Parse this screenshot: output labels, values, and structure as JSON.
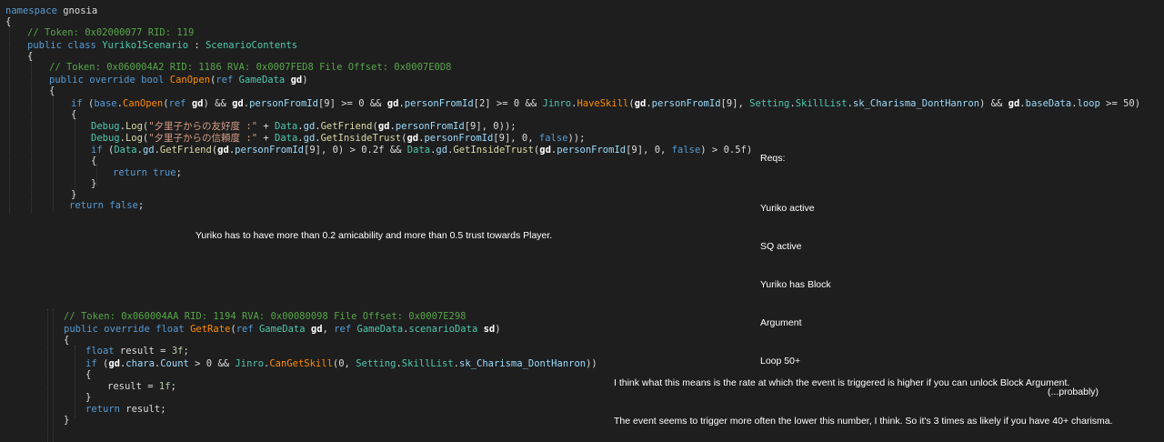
{
  "code_top": {
    "line01_ns_kw": "namespace",
    "line01_ns_name": "gnosia",
    "line02": "{",
    "line03_comment": "// Token: 0x02000077 RID: 119",
    "line04_kw": "public class",
    "line04_name": "Yuriko1Scenario",
    "line04_colon": " : ",
    "line04_base": "ScenarioContents",
    "line05": "{",
    "line06_comment": "// Token: 0x060004A2 RID: 1186 RVA: 0x0007FED8 File Offset: 0x0007E0D8",
    "line07_kw": "public override bool",
    "line07_method": "CanOpen",
    "line07_paren": "(",
    "line07_ref": "ref",
    "line07_type": "GameData",
    "line07_param": "gd",
    "line07_close": ")",
    "line08": "{",
    "line09": {
      "if": "if",
      "p1": " (",
      "base": "base",
      "dot1": ".",
      "canopen": "CanOpen",
      "p2": "(",
      "ref": "ref",
      "gd1": "gd",
      "p3": ") && ",
      "gd2": "gd",
      "dot2": ".",
      "pfi1": "personFromId",
      "idx1": "[9] >= 0 && ",
      "gd3": "gd",
      "dot3": ".",
      "pfi2": "personFromId",
      "idx2": "[2] >= 0 && ",
      "jinro": "Jinro",
      "dot4": ".",
      "haveskill": "HaveSkill",
      "p4": "(",
      "gd4": "gd",
      "dot5": ".",
      "pfi3": "personFromId",
      "idx3": "[9], ",
      "setting": "Setting",
      "dot6": ".",
      "skilllist": "SkillList",
      "dot7": ".",
      "skill": "sk_Charisma_DontHanron",
      "p5": ") && ",
      "gd5": "gd",
      "dot8": ".",
      "basedata": "baseData",
      "dot9": ".",
      "loop": "loop",
      "tail": " >= 50)"
    },
    "line10": "{",
    "line11": {
      "debug": "Debug",
      "dot": ".",
      "log": "Log",
      "p1": "(",
      "str": "\"夕里子からの友好度 :\"",
      "plus": " + ",
      "data": "Data",
      "dot2": ".",
      "gd": "gd",
      "dot3": ".",
      "getfriend": "GetFriend",
      "p2": "(",
      "gdb": "gd",
      "dot4": ".",
      "pfi": "personFromId",
      "tail": "[9], 0));"
    },
    "line12": {
      "debug": "Debug",
      "dot": ".",
      "log": "Log",
      "p1": "(",
      "str": "\"夕里子からの信頼度 :\"",
      "plus": " + ",
      "data": "Data",
      "dot2": ".",
      "gd": "gd",
      "dot3": ".",
      "getinside": "GetInsideTrust",
      "p2": "(",
      "gdb": "gd",
      "dot4": ".",
      "pfi": "personFromId",
      "mid": "[9], 0, ",
      "false": "false",
      "tail": "));"
    },
    "line13": {
      "if": "if",
      "p1": " (",
      "data1": "Data",
      "dot1": ".",
      "gd1": "gd",
      "dot2": ".",
      "getfriend": "GetFriend",
      "p2": "(",
      "gdb1": "gd",
      "dot3": ".",
      "pfi1": "personFromId",
      "mid1": "[9], 0) > 0.2f && ",
      "data2": "Data",
      "dot4": ".",
      "gd2": "gd",
      "dot5": ".",
      "getinside": "GetInsideTrust",
      "p3": "(",
      "gdb2": "gd",
      "dot6": ".",
      "pfi2": "personFromId",
      "mid2": "[9], 0, ",
      "false": "false",
      "tail": ") > 0.5f)"
    },
    "line14": "{",
    "line15_kw": "return",
    "line15_val": "true",
    "line15_semi": ";",
    "line16": "}",
    "line17": "}",
    "line18_kw": "return",
    "line18_val": "false",
    "line18_semi": ";"
  },
  "code_bottom": {
    "line1_comment": "// Token: 0x060004AA RID: 1194 RVA: 0x00080098 File Offset: 0x0007E298",
    "line2": {
      "kw": "public override float",
      "method": "GetRate",
      "p1": "(",
      "ref1": "ref",
      "type1": "GameData",
      "param1": "gd",
      "comma": ", ",
      "ref2": "ref",
      "type2": "GameData",
      "dot": ".",
      "sd_type": "scenarioData",
      "param2": "sd",
      "close": ")"
    },
    "line3": "{",
    "line4": {
      "kw": "float",
      "rest": " result = ",
      "num": "3f",
      "semi": ";"
    },
    "line5": {
      "if": "if",
      "p1": " (",
      "gd": "gd",
      "dot1": ".",
      "chara": "chara",
      "dot2": ".",
      "count": "Count",
      "mid": " > 0 && ",
      "jinro": "Jinro",
      "dot3": ".",
      "cangetskill": "CanGetSkill",
      "p2": "(0, ",
      "setting": "Setting",
      "dot4": ".",
      "skilllist": "SkillList",
      "dot5": ".",
      "skill": "sk_Charisma_DontHanron",
      "tail": "))"
    },
    "line6": "{",
    "line7": {
      "rest": "result = ",
      "num": "1f",
      "semi": ";"
    },
    "line8": "}",
    "line9": {
      "kw": "return",
      "rest": " result;"
    },
    "line10": "}"
  },
  "notes": {
    "reqs_title": "Reqs:",
    "reqs_items": [
      "Yuriko active",
      "SQ active",
      "Yuriko has Block",
      "Argument",
      "Loop 50+"
    ],
    "middle_note": "Yuriko has to have more than 0.2 amicability and more than 0.5 trust towards Player.",
    "right_note_1": "I think what this means is the rate at which the event is triggered is higher if you can unlock Block Argument.",
    "right_note_2": "The event seems to trigger more often the lower this number, I think. So it's 3 times as likely if you have 40+ charisma.",
    "right_note_3": "(...probably)"
  },
  "colors": {
    "background": "#1e1e1e",
    "keyword": "#569cd6",
    "type": "#4ec9b0",
    "method_orange": "#ff8c00",
    "property": "#9cdcfe",
    "comment": "#57a64a",
    "string": "#d69d85",
    "number": "#b5cea8"
  }
}
